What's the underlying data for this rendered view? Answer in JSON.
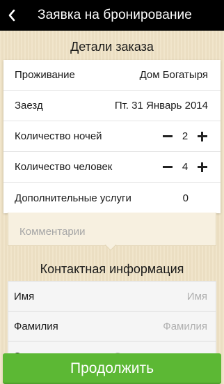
{
  "navbar": {
    "title": "Заявка на бронирование",
    "back_icon": "chevron-left-icon"
  },
  "order_details": {
    "title": "Детали заказа",
    "rows": {
      "accommodation": {
        "label": "Проживание",
        "value": "Дом Богатыря"
      },
      "checkin": {
        "label": "Заезд",
        "value": "Пт. 31 Январь 2014"
      },
      "nights": {
        "label": "Количество ночей",
        "value": "2"
      },
      "guests": {
        "label": "Количество человек",
        "value": "4"
      },
      "extras": {
        "label": "Дополнительные услуги",
        "value": "0"
      }
    },
    "comment_placeholder": "Комментарии"
  },
  "contact": {
    "title": "Контактная информация",
    "name": {
      "label": "Имя",
      "placeholder": "Имя"
    },
    "surname": {
      "label": "Фамилия",
      "placeholder": "Фамилия"
    },
    "email": {
      "label": "Эл. почта",
      "placeholder": "Электронная почта"
    }
  },
  "continue_label": "Продолжить",
  "colors": {
    "background": "#efe2c5",
    "navbar": "#000000",
    "continue_button": "#5cb834"
  }
}
